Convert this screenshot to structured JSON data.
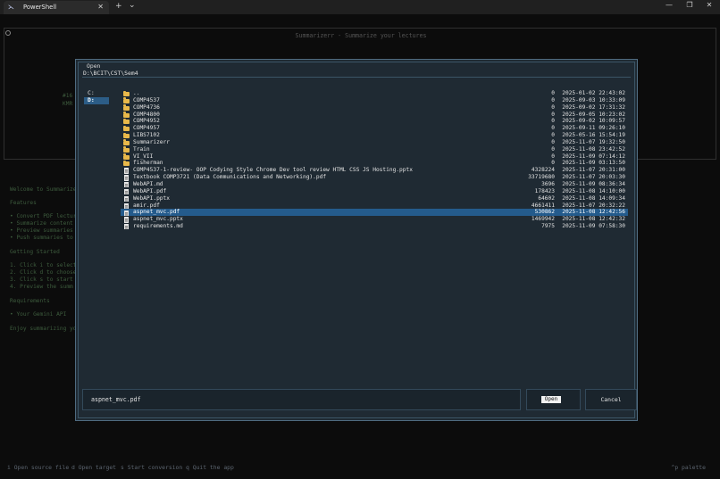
{
  "window": {
    "tab_title": "PowerShell",
    "tab_icon": "powershell-icon",
    "close_tab": "✕",
    "new_tab": "+",
    "tab_dropdown": "⌄",
    "minimize": "—",
    "maximize": "❐",
    "close": "✕"
  },
  "app": {
    "title": "Summarizerr - Summarize your lectures",
    "background_lines": [
      "Welcome to Summarizerr",
      "Features",
      "• Convert PDF lectures",
      "• Summarize content",
      "• Preview summaries",
      "• Push summaries to",
      "Getting Started",
      "1. Click i to select",
      "2. Click d to choose",
      "3. Click s to start",
      "4. Preview the summ",
      "Requirements",
      "• Your Gemini API",
      "Enjoy summarizing yo"
    ],
    "side_fragments": [
      "#16",
      "KMR"
    ]
  },
  "footer": {
    "open_source": "i Open source file",
    "open_target": "d Open target",
    "start_conversion": "s Start conversion",
    "quit": "q Quit the app",
    "palette": "^p palette"
  },
  "dialog": {
    "title": "Open",
    "path": "D:\\BCIT\\CST\\Sem4",
    "drives": [
      {
        "label": "C:",
        "active": false
      },
      {
        "label": "D:",
        "active": true
      }
    ],
    "entries": [
      {
        "name": "..",
        "type": "folder",
        "size": "0",
        "date": "2025-01-02 22:43:02",
        "selected": false
      },
      {
        "name": "COMP4537",
        "type": "folder",
        "size": "0",
        "date": "2025-09-03 10:33:09",
        "selected": false
      },
      {
        "name": "COMP4736",
        "type": "folder",
        "size": "0",
        "date": "2025-09-02 17:31:32",
        "selected": false
      },
      {
        "name": "COMP4800",
        "type": "folder",
        "size": "0",
        "date": "2025-09-05 10:23:02",
        "selected": false
      },
      {
        "name": "COMP4952",
        "type": "folder",
        "size": "0",
        "date": "2025-09-02 10:09:57",
        "selected": false
      },
      {
        "name": "COMP4957",
        "type": "folder",
        "size": "0",
        "date": "2025-09-11 09:26:10",
        "selected": false
      },
      {
        "name": "LIBS7102",
        "type": "folder",
        "size": "0",
        "date": "2025-05-16 15:54:19",
        "selected": false
      },
      {
        "name": "Summarizerr",
        "type": "folder",
        "size": "0",
        "date": "2025-11-07 19:32:50",
        "selected": false
      },
      {
        "name": "Train",
        "type": "folder",
        "size": "0",
        "date": "2025-11-08 23:42:52",
        "selected": false
      },
      {
        "name": "VI_VII",
        "type": "folder",
        "size": "0",
        "date": "2025-11-09 07:14:12",
        "selected": false
      },
      {
        "name": "fisherman",
        "type": "folder",
        "size": "0",
        "date": "2025-11-09 03:13:50",
        "selected": false
      },
      {
        "name": "COMP4537-1-review- OOP Codying Style Chrome Dev tool review HTML CSS JS Hosting.pptx",
        "type": "file",
        "size": "4328224",
        "date": "2025-11-07 20:31:00",
        "selected": false
      },
      {
        "name": "Textbook COMP3721 (Data Communications and Networking).pdf",
        "type": "file",
        "size": "33719680",
        "date": "2025-11-07 20:03:30",
        "selected": false
      },
      {
        "name": "WebAPI.md",
        "type": "file",
        "size": "3696",
        "date": "2025-11-09 08:36:34",
        "selected": false
      },
      {
        "name": "WebAPI.pdf",
        "type": "file",
        "size": "178423",
        "date": "2025-11-08 14:10:00",
        "selected": false
      },
      {
        "name": "WebAPI.pptx",
        "type": "file",
        "size": "64602",
        "date": "2025-11-08 14:09:34",
        "selected": false
      },
      {
        "name": "amir.pdf",
        "type": "file",
        "size": "4661411",
        "date": "2025-11-07 20:32:22",
        "selected": false
      },
      {
        "name": "aspnet_mvc.pdf",
        "type": "file",
        "size": "530862",
        "date": "2025-11-08 12:42:56",
        "selected": true
      },
      {
        "name": "aspnet_mvc.pptx",
        "type": "file",
        "size": "1469942",
        "date": "2025-11-08 12:42:32",
        "selected": false
      },
      {
        "name": "requirements.md",
        "type": "file",
        "size": "7975",
        "date": "2025-11-09 07:58:30",
        "selected": false
      }
    ],
    "filename_value": "aspnet_mvc.pdf",
    "open_label": "Open",
    "cancel_label": "Cancel"
  }
}
